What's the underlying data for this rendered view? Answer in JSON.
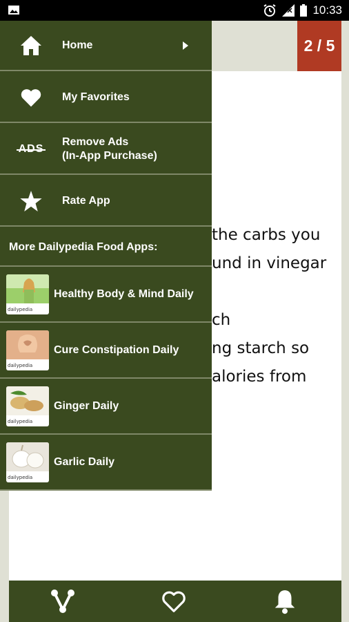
{
  "status_bar": {
    "time": "10:33"
  },
  "page": {
    "counter": "2 / 5",
    "lines": [
      "the carbs you",
      "und in vinegar",
      "ch",
      "ng starch so",
      "alories from"
    ]
  },
  "drawer": {
    "menu": [
      {
        "label": "Home",
        "icon": "home-icon"
      },
      {
        "label": "My Favorites",
        "icon": "heart-icon"
      },
      {
        "label_line1": "Remove Ads",
        "label_line2": "(In-App Purchase)",
        "icon": "no-ads-icon",
        "icon_text": "ADS"
      },
      {
        "label": "Rate App",
        "icon": "star-icon"
      }
    ],
    "section_title": "More Dailypedia Food Apps:",
    "apps": [
      {
        "label": "Healthy Body & Mind Daily",
        "brand": "dailypedia"
      },
      {
        "label": "Cure Constipation Daily",
        "brand": "dailypedia"
      },
      {
        "label": "Ginger Daily",
        "brand": "dailypedia"
      },
      {
        "label": "Garlic Daily",
        "brand": "dailypedia"
      }
    ]
  },
  "bottom_bar": {
    "buttons": [
      "share-icon",
      "heart-outline-icon",
      "bell-icon"
    ]
  },
  "colors": {
    "drawer": "#3a4a1f",
    "accent": "#b03a23",
    "background": "#dfe0d4"
  }
}
